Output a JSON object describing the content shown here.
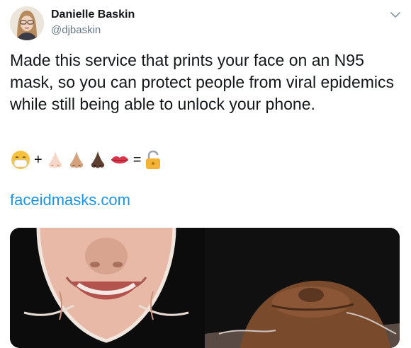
{
  "author": {
    "name": "Danielle Baskin",
    "handle": "@djbaskin"
  },
  "tweet": {
    "text": "Made this service that prints your face on an N95 mask, so you can protect people from viral epidemics while still being able to unlock your phone.",
    "equation": {
      "operators": [
        "+",
        "="
      ],
      "icons": [
        "mask-face-emoji",
        "nose-light-emoji",
        "nose-medium-emoji",
        "nose-dark-emoji",
        "lips-emoji",
        "unlocked-padlock-emoji"
      ]
    },
    "link": "faceidmasks.com"
  },
  "colors": {
    "text": "#14171a",
    "secondary": "#657786",
    "link": "#1b95e0"
  },
  "icons": {
    "more": "chevron-down-icon"
  }
}
